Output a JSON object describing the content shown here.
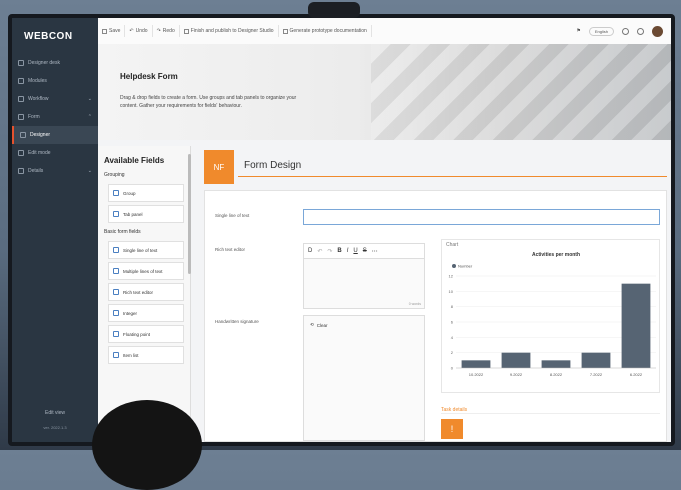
{
  "sidebar": {
    "logo": "WEBCON",
    "items": [
      {
        "label": "Designer desk"
      },
      {
        "label": "Modules"
      },
      {
        "label": "Workflow"
      },
      {
        "label": "Form"
      },
      {
        "label": "Designer"
      },
      {
        "label": "Edit mode"
      },
      {
        "label": "Details"
      }
    ],
    "footer": "Edit view",
    "version": "ver. 2022.1.3"
  },
  "toolbar": {
    "save": "Save",
    "undo": "Undo",
    "redo": "Redo",
    "publish": "Finish and publish to Designer Studio",
    "docs": "Generate prototype documentation",
    "language": "English"
  },
  "banner": {
    "title": "Helpdesk Form",
    "description": "Drag & drop fields to create a form. Use groups and tab panels to organize your content. Gather your requirements for fields' behaviour."
  },
  "available_fields": {
    "title": "Available Fields",
    "grouping_title": "Grouping",
    "grouping": [
      "Group",
      "Tab panel"
    ],
    "basic_title": "Basic form fields",
    "basic": [
      "Single line of text",
      "Multiple lines of text",
      "Rich text editor",
      "Integer",
      "Floating point",
      "Item list"
    ]
  },
  "design": {
    "badge": "NF",
    "title": "Form Design",
    "single_line_label": "Single line of text",
    "rich_text_label": "Rich text editor",
    "rte_counter": "0 words",
    "signature_label": "Handwritten signature",
    "clear_label": "Clear",
    "chart_section": "Chart",
    "task_section": "Task details",
    "task_badge": "!"
  },
  "chart_data": {
    "type": "bar",
    "title": "Activities per month",
    "series": [
      {
        "name": "Number",
        "values": [
          1.0,
          2.0,
          1.0,
          2.0,
          11.0
        ]
      }
    ],
    "categories": [
      "10.2022",
      "9.2022",
      "8.2022",
      "7.2022",
      "6.2022"
    ],
    "ylim": [
      0,
      12
    ],
    "yticks": [
      0,
      2,
      4,
      6,
      8,
      10,
      12
    ],
    "color": "#566473",
    "grid": true,
    "legend": "top-left"
  },
  "colors": {
    "accent": "#f08a2c",
    "sidebar": "#2a3642",
    "focus": "#7aa7d8"
  }
}
